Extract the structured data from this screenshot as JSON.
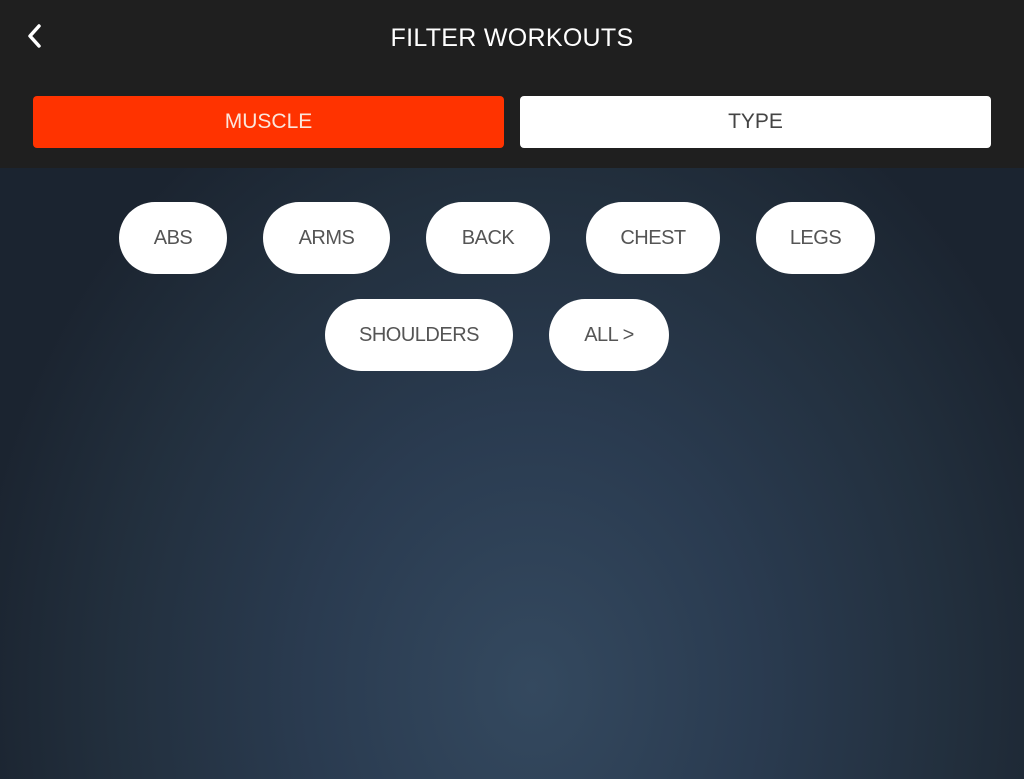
{
  "header": {
    "title": "FILTER WORKOUTS",
    "back_icon": "chevron-left-icon"
  },
  "tabs": [
    {
      "label": "MUSCLE",
      "active": true
    },
    {
      "label": "TYPE",
      "active": false
    }
  ],
  "colors": {
    "accent": "#ff3300",
    "header_bg": "#1f1f1f"
  },
  "filters": [
    {
      "label": "ABS"
    },
    {
      "label": "ARMS"
    },
    {
      "label": "BACK"
    },
    {
      "label": "CHEST"
    },
    {
      "label": "LEGS"
    },
    {
      "label": "SHOULDERS"
    },
    {
      "label": "ALL >"
    }
  ]
}
